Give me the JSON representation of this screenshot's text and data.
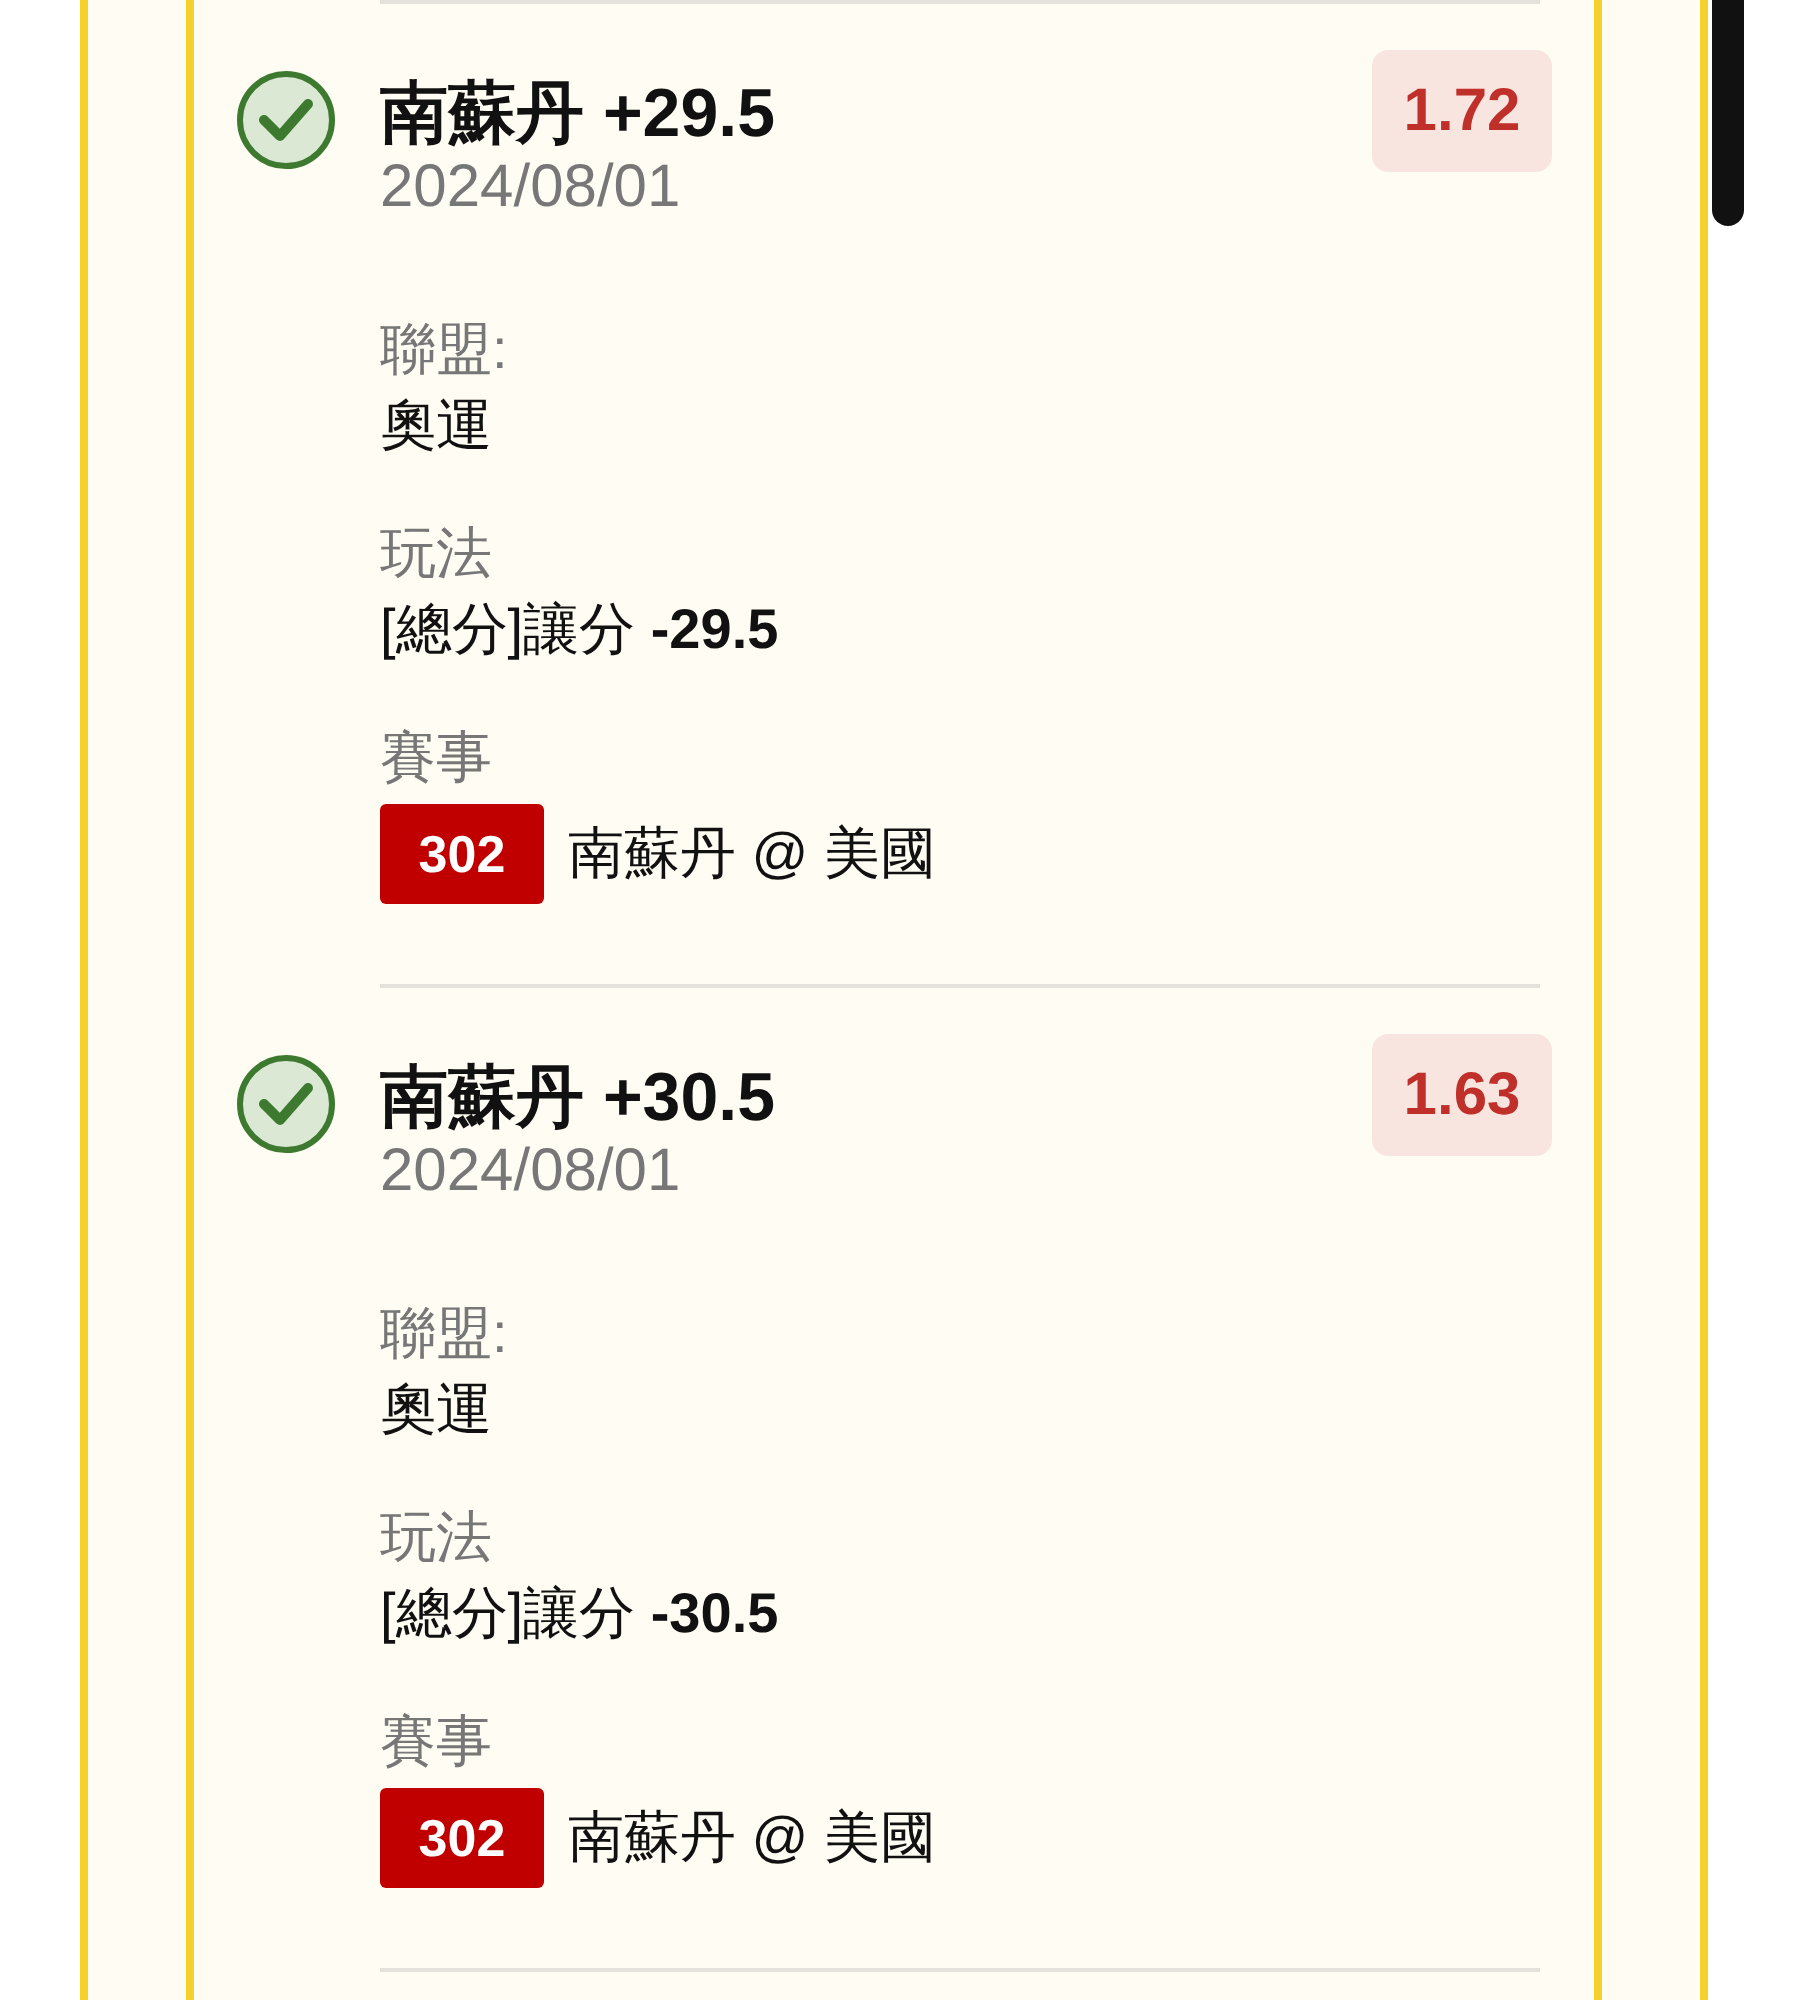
{
  "bets": [
    {
      "won": true,
      "title": "南蘇丹 +29.5",
      "date": "2024/08/01",
      "odds": "1.72",
      "fields": [
        {
          "kind": "text",
          "label": "聯盟:",
          "value": "奧運"
        },
        {
          "kind": "text",
          "label": "玩法",
          "value": "[總分]讓分 **-29.5**"
        },
        {
          "kind": "event",
          "label": "賽事",
          "code": "302",
          "value": "南蘇丹 @ 美國"
        }
      ]
    },
    {
      "won": true,
      "title": "南蘇丹 +30.5",
      "date": "2024/08/01",
      "odds": "1.63",
      "fields": [
        {
          "kind": "text",
          "label": "聯盟:",
          "value": "奧運"
        },
        {
          "kind": "text",
          "label": "玩法",
          "value": "[總分]讓分 **-30.5**"
        },
        {
          "kind": "event",
          "label": "賽事",
          "code": "302",
          "value": "南蘇丹 @ 美國"
        }
      ]
    }
  ]
}
